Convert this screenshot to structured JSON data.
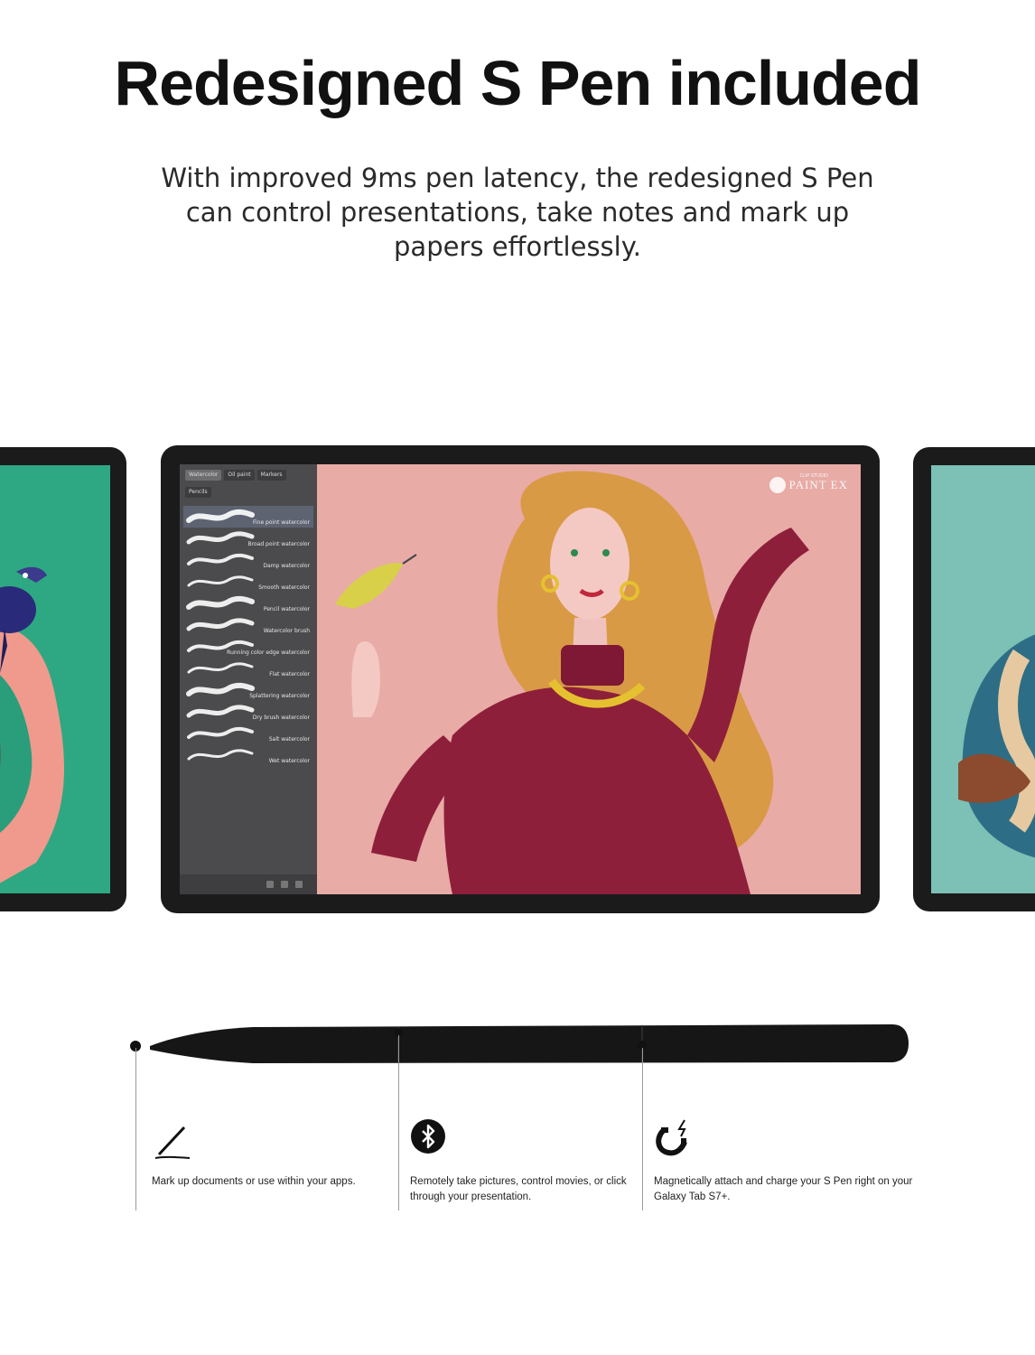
{
  "headline": "Redesigned S Pen included",
  "subtext": "With improved 9ms pen latency, the redesigned S Pen can control presentations, take notes and mark up papers effortlessly.",
  "app": {
    "tabs": [
      "Watercolor",
      "Oil paint",
      "Markers",
      "Pencils"
    ],
    "brushes": [
      "Fine point watercolor",
      "Broad point watercolor",
      "Damp watercolor",
      "Smooth watercolor",
      "Pencil watercolor",
      "Watercolor brush",
      "Running color edge watercolor",
      "Flat watercolor",
      "Splattering watercolor",
      "Dry brush watercolor",
      "Salt watercolor",
      "Wet watercolor"
    ],
    "logo_small": "CLIP STUDIO",
    "logo": "PAINT EX"
  },
  "features": [
    {
      "icon": "pen-icon",
      "text": "Mark up documents or use within your apps."
    },
    {
      "icon": "bluetooth-icon",
      "text": "Remotely take pictures, control movies, or click through your presentation."
    },
    {
      "icon": "magnet-icon",
      "text": "Magnetically attach and charge your S Pen right on your Galaxy Tab S7+."
    }
  ],
  "colors": {
    "pen": "#161616",
    "tablet_bezel": "#1b1b1c",
    "canvas_pink": "#e8aba6",
    "sweater": "#8e1f3a",
    "hair": "#d99a45"
  }
}
